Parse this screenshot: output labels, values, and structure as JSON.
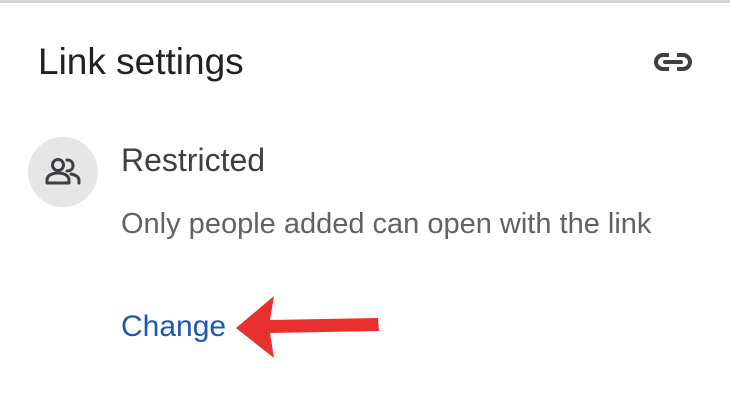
{
  "header": {
    "title": "Link settings",
    "icon": "link-icon"
  },
  "access": {
    "icon": "people-icon",
    "title": "Restricted",
    "description": "Only people added can open with the link",
    "change_label": "Change"
  },
  "annotation": {
    "icon": "red-arrow-icon",
    "color": "#e8302f"
  },
  "colors": {
    "link": "#1a57b8",
    "title_text": "#202124",
    "body_text": "#5f6368",
    "avatar_bg": "#e6e6e6"
  }
}
